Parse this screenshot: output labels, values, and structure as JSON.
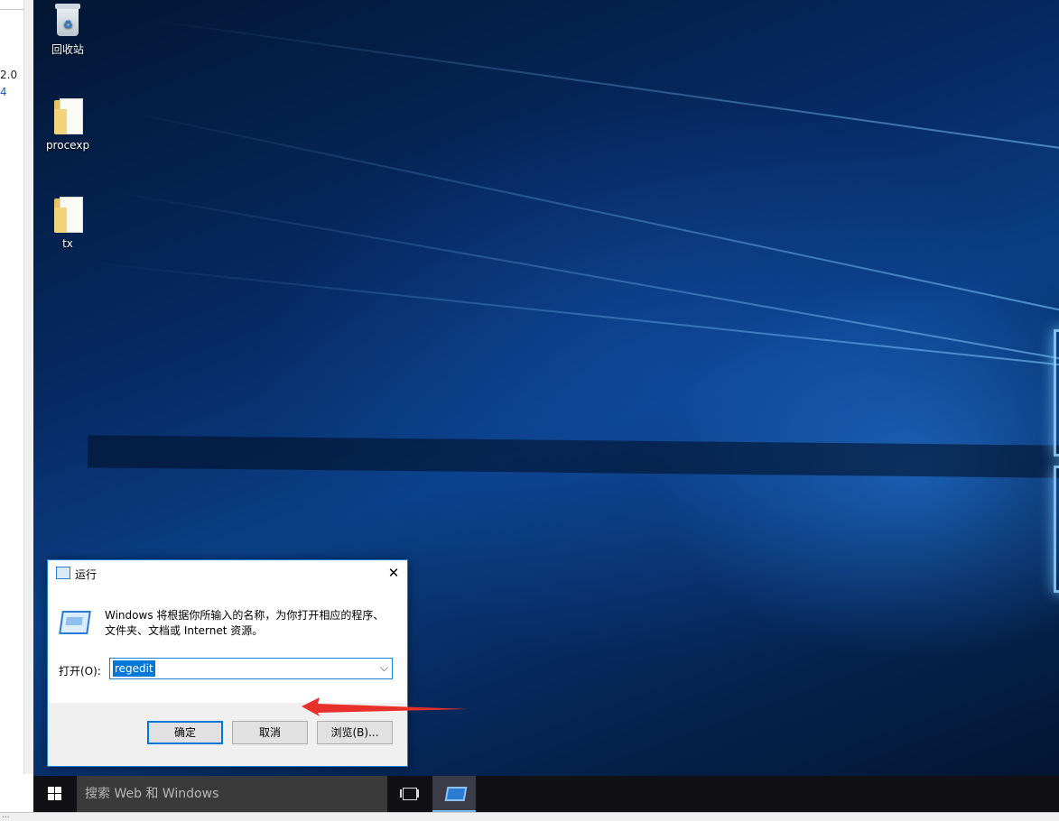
{
  "left_window": {
    "text_top": "2.0",
    "text_bottom": "4"
  },
  "desktop": {
    "icons": [
      {
        "label": "回收站",
        "icon": "recycle-bin-icon"
      },
      {
        "label": "procexp",
        "icon": "folder-icon"
      },
      {
        "label": "tx",
        "icon": "folder-icon"
      }
    ]
  },
  "run_dialog": {
    "title": "运行",
    "description": "Windows 将根据你所输入的名称，为你打开相应的程序、文件夹、文档或 Internet 资源。",
    "open_label": "打开(O):",
    "input_value": "regedit",
    "buttons": {
      "ok": "确定",
      "cancel": "取消",
      "browse": "浏览(B)..."
    }
  },
  "taskbar": {
    "search_placeholder": "搜索 Web 和 Windows"
  },
  "bottom_strip_text": "...",
  "colors": {
    "accent": "#0078d7",
    "taskbar": "#101015",
    "annotation_arrow": "#e8312a"
  }
}
